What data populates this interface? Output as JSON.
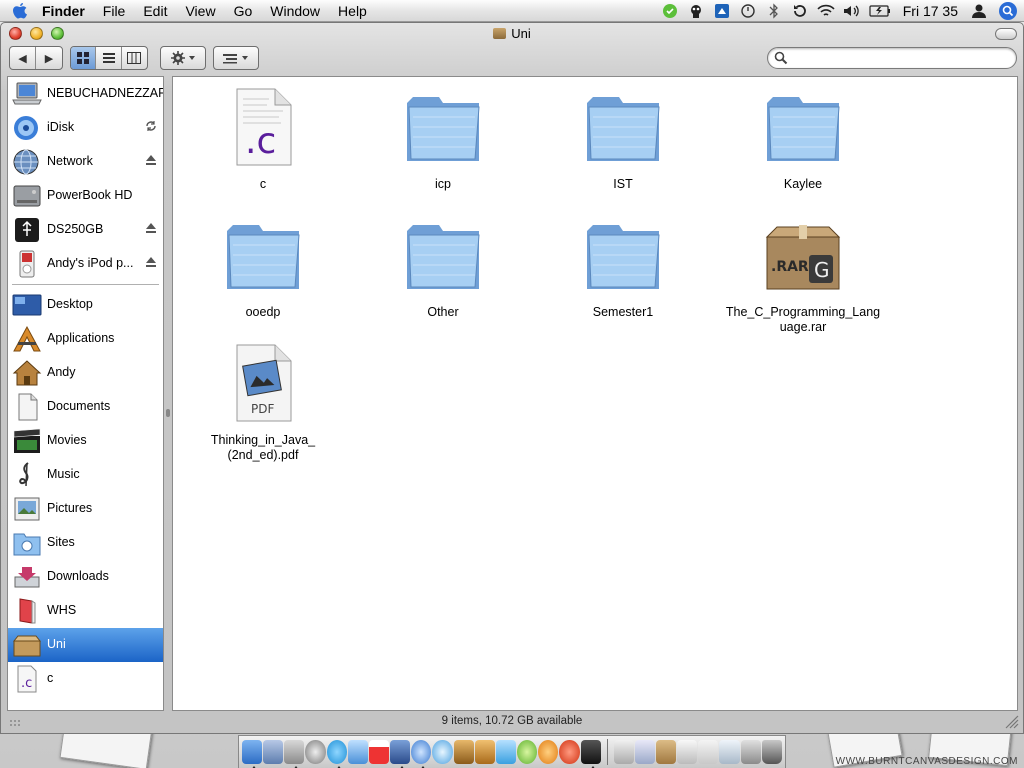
{
  "menubar": {
    "app_name": "Finder",
    "menus": [
      "File",
      "Edit",
      "View",
      "Go",
      "Window",
      "Help"
    ],
    "clock": "Fri 17 35",
    "extras": [
      "evernote-icon",
      "alien-icon",
      "dashboard-icon",
      "sync-circle-icon",
      "bluetooth-icon",
      "time-machine-icon",
      "wifi-icon",
      "volume-icon",
      "battery-icon",
      "user-icon",
      "spotlight-icon"
    ]
  },
  "window": {
    "title": "Uni",
    "status": "9 items, 10.72 GB available"
  },
  "toolbar": {
    "back_label": "◀",
    "forward_label": "▶",
    "search_placeholder": ""
  },
  "sidebar": {
    "devices": [
      {
        "label": "NEBUCHADNEZZAR",
        "icon": "laptop-icon"
      },
      {
        "label": "iDisk",
        "icon": "idisk-icon"
      },
      {
        "label": "Network",
        "icon": "network-globe-icon"
      },
      {
        "label": "PowerBook HD",
        "icon": "hard-drive-icon"
      },
      {
        "label": "DS250GB",
        "icon": "usb-drive-icon"
      },
      {
        "label": "Andy's iPod p...",
        "icon": "ipod-icon"
      }
    ],
    "places": [
      {
        "label": "Desktop",
        "icon": "desktop-icon"
      },
      {
        "label": "Applications",
        "icon": "applications-icon"
      },
      {
        "label": "Andy",
        "icon": "home-icon"
      },
      {
        "label": "Documents",
        "icon": "documents-icon"
      },
      {
        "label": "Movies",
        "icon": "movies-icon"
      },
      {
        "label": "Music",
        "icon": "music-icon"
      },
      {
        "label": "Pictures",
        "icon": "pictures-icon"
      },
      {
        "label": "Sites",
        "icon": "sites-icon"
      },
      {
        "label": "Downloads",
        "icon": "downloads-icon"
      },
      {
        "label": "WHS",
        "icon": "book-icon"
      },
      {
        "label": "Uni",
        "icon": "box-folder-icon"
      },
      {
        "label": "c",
        "icon": "c-file-icon"
      }
    ]
  },
  "files": [
    {
      "name": "c",
      "kind": "c-source-file"
    },
    {
      "name": "icp",
      "kind": "folder"
    },
    {
      "name": "IST",
      "kind": "folder"
    },
    {
      "name": "Kaylee",
      "kind": "folder"
    },
    {
      "name": "ooedp",
      "kind": "folder"
    },
    {
      "name": "Other",
      "kind": "folder"
    },
    {
      "name": "Semester1",
      "kind": "folder"
    },
    {
      "name": "The_C_Programming_Language.rar",
      "name_line1": "The_C_Programming_Lang",
      "name_line2": "uage.rar",
      "kind": "rar-archive"
    },
    {
      "name": "Thinking_in_Java_(2nd_ed).pdf",
      "name_line1": "Thinking_in_Java_",
      "name_line2": "(2nd_ed).pdf",
      "kind": "pdf-file"
    }
  ],
  "icon_labels": {
    "c_file": ".c",
    "pdf": "PDF",
    "rar": ".RAR"
  },
  "watermark": "WWW.BURNTCANVASDESIGN.COM",
  "colors": {
    "selection": "#1b64c7",
    "folder_blue": "#8fc0ef",
    "c_purple": "#5a1e9c"
  }
}
